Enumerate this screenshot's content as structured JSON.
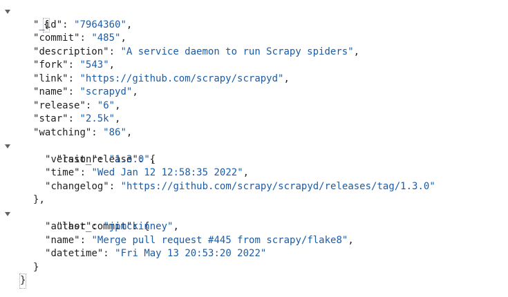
{
  "json_viewer": {
    "open_brace": "{",
    "close_brace": "}",
    "fields": [
      {
        "key": "_id",
        "value": "7964360"
      },
      {
        "key": "commit",
        "value": "485"
      },
      {
        "key": "description",
        "value": "A service daemon to run Scrapy spiders"
      },
      {
        "key": "fork",
        "value": "543"
      },
      {
        "key": "link",
        "value": "https://github.com/scrapy/scrapyd"
      },
      {
        "key": "name",
        "value": "scrapyd"
      },
      {
        "key": "release",
        "value": "6"
      },
      {
        "key": "star",
        "value": "2.5k"
      },
      {
        "key": "watching",
        "value": "86"
      }
    ],
    "last_release": {
      "key": "last_release",
      "fields": [
        {
          "key": "version",
          "value": "1.3.0"
        },
        {
          "key": "time",
          "value": "Wed Jan 12 12:58:35 2022"
        },
        {
          "key": "changelog",
          "value": "https://github.com/scrapy/scrapyd/releases/tag/1.3.0"
        }
      ]
    },
    "last_commit": {
      "key": "last_commit",
      "fields": [
        {
          "key": "author",
          "value": "jpmckinney"
        },
        {
          "key": "name",
          "value": "Merge pull request #445 from scrapy/flake8"
        },
        {
          "key": "datetime",
          "value": "Fri May 13 20:53:20 2022"
        }
      ]
    }
  }
}
